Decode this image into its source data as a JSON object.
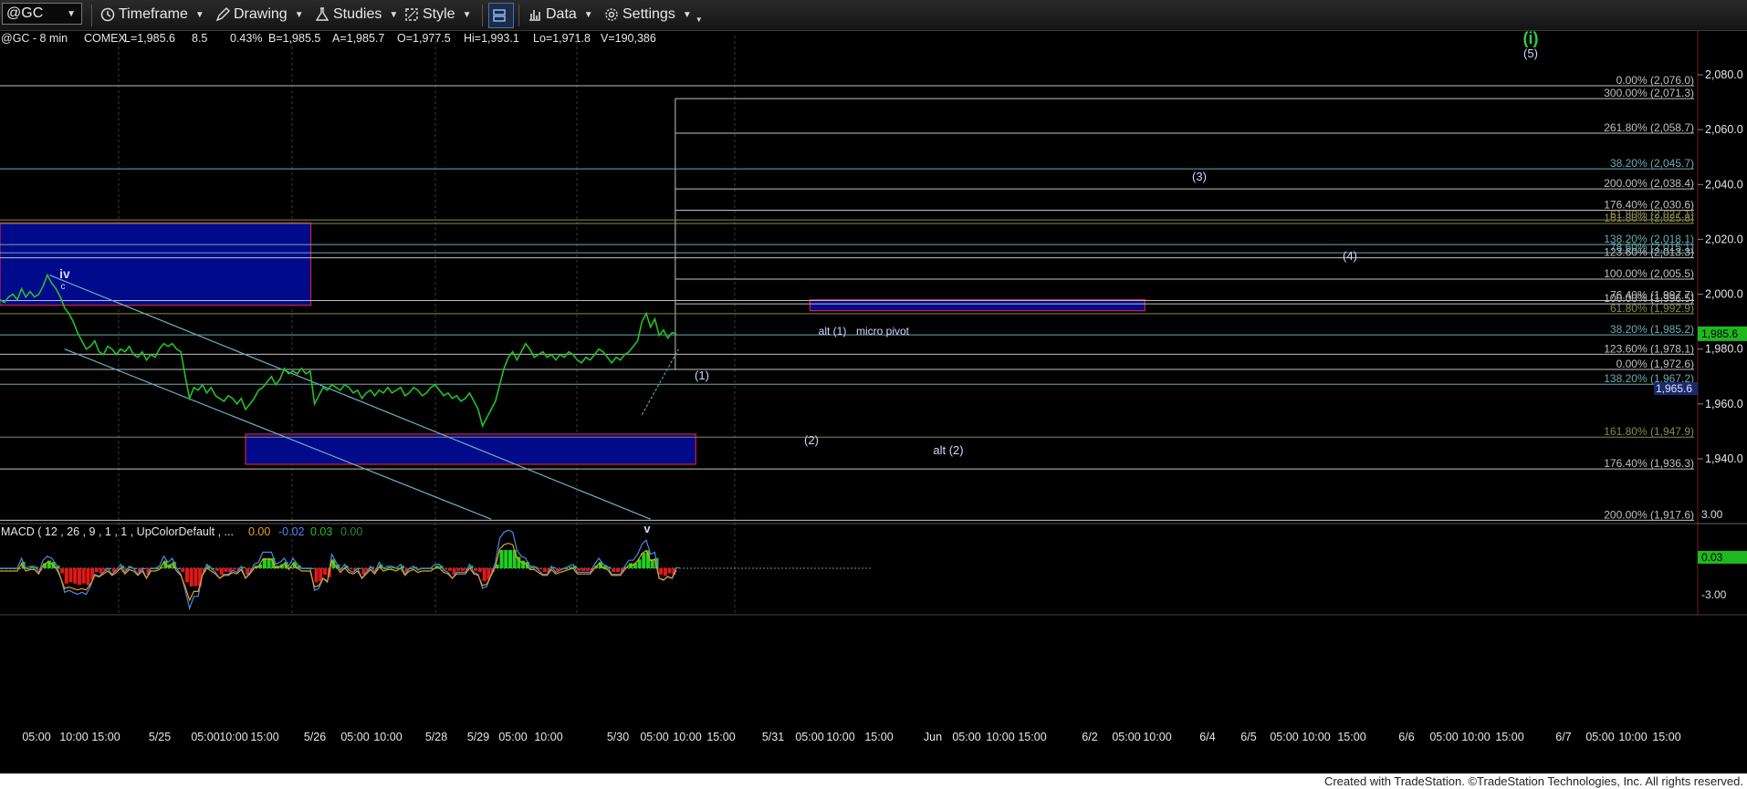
{
  "toolbar": {
    "symbol": "@GC",
    "timeframe": "Timeframe",
    "drawing": "Drawing",
    "studies": "Studies",
    "style": "Style",
    "data": "Data",
    "settings": "Settings"
  },
  "header": {
    "symbol": "@GC - 8 min",
    "exchange": "COMEX",
    "last": "L=1,985.6",
    "change": "8.5",
    "change_pct": "0.43%",
    "bid": "B=1,985.5",
    "ask": "A=1,985.7",
    "open": "O=1,977.5",
    "high": "Hi=1,993.1",
    "low": "Lo=1,971.8",
    "volume": "V=190,386"
  },
  "footer": "Created with TradeStation. ©TradeStation Technologies, Inc. All rights reserved.",
  "colors": {
    "price": "#22c02a",
    "fib_white": "#bfbfbf",
    "fib_olive": "#8a8a4e",
    "fib_teal": "#6aaab0",
    "box_fill": "#000a8a",
    "box_border": "#d02040",
    "channel": "#6ab0c0",
    "accent_green": "#2ecc40"
  },
  "chart_data": {
    "type": "line",
    "title": "@GC - 8 min",
    "ylim": [
      1910,
      2092
    ],
    "yticks": [
      "2,080.0",
      "2,060.0",
      "2,040.0",
      "2,020.0",
      "2,000.0",
      "1,980.0",
      "1,960.0",
      "1,940.0"
    ],
    "ytick_values": [
      2080,
      2060,
      2040,
      2020,
      2000,
      1980,
      1960,
      1940
    ],
    "last_price": "1,985.6",
    "last_value": 1985.6,
    "secondary_price_label": "1,965.6",
    "xticks": [
      "05:00",
      "10:00",
      "15:00",
      "5/25",
      "05:00",
      "10:00",
      "15:00",
      "5/26",
      "05:00",
      "10:00",
      "5/28",
      "5/29",
      "05:00",
      "10:00",
      "5/30",
      "05:00",
      "10:00",
      "15:00",
      "5/31",
      "05:00",
      "10:00",
      "15:00",
      "Jun",
      "05:00",
      "10:00",
      "15:00",
      "6/2",
      "05:00",
      "10:00",
      "6/4",
      "6/5",
      "05:00",
      "10:00",
      "15:00",
      "6/6",
      "05:00",
      "10:00",
      "15:00",
      "6/7",
      "05:00",
      "10:00",
      "15:00"
    ],
    "fib_levels": [
      {
        "label": "0.00% (2,076.0)",
        "value": 2076.0,
        "tone": "white"
      },
      {
        "label": "300.00% (2,071.3)",
        "value": 2071.3,
        "tone": "white"
      },
      {
        "label": "261.80% (2,058.7)",
        "value": 2058.7,
        "tone": "white"
      },
      {
        "label": "38.20% (2,045.7)",
        "value": 2045.7,
        "tone": "teal"
      },
      {
        "label": "200.00% (2,038.4)",
        "value": 2038.4,
        "tone": "white"
      },
      {
        "label": "176.40% (2,030.6)",
        "value": 2030.6,
        "tone": "white"
      },
      {
        "label": "61.80% (2,027.1)",
        "value": 2027.1,
        "tone": "olive"
      },
      {
        "label": "161.80% (2,025.8)",
        "value": 2025.8,
        "tone": "olive"
      },
      {
        "label": "138.20% (2,018.1)",
        "value": 2018.1,
        "tone": "teal"
      },
      {
        "label": "78.60% (2,015.1)",
        "value": 2015.1,
        "tone": "teal"
      },
      {
        "label": "123.60% (2,013.3)",
        "value": 2013.3,
        "tone": "white"
      },
      {
        "label": "100.00% (2,005.5)",
        "value": 2005.5,
        "tone": "white"
      },
      {
        "label": "76.40% (1,997.7)",
        "value": 1997.7,
        "tone": "white"
      },
      {
        "label": "100.00% (1,996.5)",
        "value": 1996.5,
        "tone": "white"
      },
      {
        "label": "61.80% (1,992.9)",
        "value": 1992.9,
        "tone": "olive"
      },
      {
        "label": "38.20% (1,985.2)",
        "value": 1985.2,
        "tone": "teal"
      },
      {
        "label": "123.60% (1,978.1)",
        "value": 1978.1,
        "tone": "white"
      },
      {
        "label": "0.00% (1,972.6)",
        "value": 1972.6,
        "tone": "white"
      },
      {
        "label": "138.20% (1,967.2)",
        "value": 1967.2,
        "tone": "teal"
      },
      {
        "label": "161.80% (1,947.9)",
        "value": 1947.9,
        "tone": "olive"
      },
      {
        "label": "176.40% (1,936.3)",
        "value": 1936.3,
        "tone": "white"
      },
      {
        "label": "200.00% (1,917.6)",
        "value": 1917.6,
        "tone": "white"
      }
    ],
    "wave_labels": [
      "iv",
      "c",
      "v",
      "(1)",
      "(2)",
      "alt (1)",
      "micro pivot",
      "alt (2)",
      "(3)",
      "(4)",
      "(5)",
      "(i)"
    ],
    "price_series": [
      [
        0,
        1998
      ],
      [
        0.02,
        1997
      ],
      [
        0.04,
        1999
      ],
      [
        0.06,
        2000
      ],
      [
        0.08,
        1998
      ],
      [
        0.1,
        2002
      ],
      [
        0.12,
        1999
      ],
      [
        0.14,
        2001
      ],
      [
        0.16,
        1999
      ],
      [
        0.18,
        2000
      ],
      [
        0.2,
        2003
      ],
      [
        0.22,
        2007
      ],
      [
        0.24,
        2004
      ],
      [
        0.26,
        2002
      ],
      [
        0.28,
        1999
      ],
      [
        0.3,
        1995
      ],
      [
        0.32,
        1993
      ],
      [
        0.34,
        1990
      ],
      [
        0.36,
        1986
      ],
      [
        0.38,
        1983
      ],
      [
        0.4,
        1980
      ],
      [
        0.42,
        1981
      ],
      [
        0.44,
        1983
      ],
      [
        0.46,
        1979
      ],
      [
        0.48,
        1978
      ],
      [
        0.5,
        1981
      ],
      [
        0.52,
        1980
      ],
      [
        0.54,
        1978
      ],
      [
        0.56,
        1980
      ],
      [
        0.58,
        1979
      ],
      [
        0.6,
        1981
      ],
      [
        0.62,
        1978
      ],
      [
        0.64,
        1977
      ],
      [
        0.66,
        1979
      ],
      [
        0.68,
        1976
      ],
      [
        0.7,
        1978
      ],
      [
        0.72,
        1977
      ],
      [
        0.74,
        1980
      ],
      [
        0.76,
        1982
      ],
      [
        0.78,
        1981
      ],
      [
        0.8,
        1982
      ],
      [
        0.82,
        1980
      ],
      [
        0.84,
        1979
      ],
      [
        0.86,
        1970
      ],
      [
        0.88,
        1962
      ],
      [
        0.9,
        1966
      ],
      [
        0.92,
        1965
      ],
      [
        0.94,
        1967
      ],
      [
        0.96,
        1964
      ],
      [
        0.98,
        1966
      ],
      [
        1.0,
        1963
      ],
      [
        1.02,
        1962
      ],
      [
        1.04,
        1961
      ],
      [
        1.06,
        1963
      ],
      [
        1.08,
        1962
      ],
      [
        1.1,
        1960
      ],
      [
        1.12,
        1962
      ],
      [
        1.14,
        1958
      ],
      [
        1.16,
        1960
      ],
      [
        1.18,
        1962
      ],
      [
        1.2,
        1965
      ],
      [
        1.22,
        1966
      ],
      [
        1.24,
        1968
      ],
      [
        1.26,
        1970
      ],
      [
        1.28,
        1967
      ],
      [
        1.3,
        1969
      ],
      [
        1.32,
        1973
      ],
      [
        1.34,
        1971
      ],
      [
        1.36,
        1972
      ],
      [
        1.38,
        1971
      ],
      [
        1.4,
        1973
      ],
      [
        1.42,
        1971
      ],
      [
        1.44,
        1972
      ],
      [
        1.46,
        1960
      ],
      [
        1.48,
        1963
      ],
      [
        1.5,
        1966
      ],
      [
        1.52,
        1965
      ],
      [
        1.54,
        1967
      ],
      [
        1.56,
        1966
      ],
      [
        1.58,
        1965
      ],
      [
        1.6,
        1967
      ],
      [
        1.62,
        1966
      ],
      [
        1.64,
        1964
      ],
      [
        1.66,
        1965
      ],
      [
        1.68,
        1962
      ],
      [
        1.7,
        1964
      ],
      [
        1.72,
        1965
      ],
      [
        1.74,
        1963
      ],
      [
        1.76,
        1965
      ],
      [
        1.78,
        1964
      ],
      [
        1.8,
        1966
      ],
      [
        1.82,
        1964
      ],
      [
        1.84,
        1965
      ],
      [
        1.86,
        1966
      ],
      [
        1.88,
        1963
      ],
      [
        1.9,
        1964
      ],
      [
        1.92,
        1966
      ],
      [
        1.94,
        1965
      ],
      [
        1.96,
        1963
      ],
      [
        1.98,
        1964
      ],
      [
        2.0,
        1966
      ],
      [
        2.02,
        1967
      ],
      [
        2.04,
        1965
      ],
      [
        2.06,
        1963
      ],
      [
        2.08,
        1964
      ],
      [
        2.1,
        1962
      ],
      [
        2.12,
        1963
      ],
      [
        2.14,
        1961
      ],
      [
        2.16,
        1962
      ],
      [
        2.18,
        1964
      ],
      [
        2.2,
        1961
      ],
      [
        2.22,
        1958
      ],
      [
        2.24,
        1952
      ],
      [
        2.26,
        1955
      ],
      [
        2.28,
        1958
      ],
      [
        2.3,
        1961
      ],
      [
        2.32,
        1967
      ],
      [
        2.34,
        1973
      ],
      [
        2.36,
        1977
      ],
      [
        2.38,
        1979
      ],
      [
        2.4,
        1976
      ],
      [
        2.42,
        1979
      ],
      [
        2.44,
        1982
      ],
      [
        2.46,
        1980
      ],
      [
        2.48,
        1977
      ],
      [
        2.5,
        1978
      ],
      [
        2.52,
        1979
      ],
      [
        2.54,
        1977
      ],
      [
        2.56,
        1978
      ],
      [
        2.58,
        1976
      ],
      [
        2.6,
        1978
      ],
      [
        2.62,
        1977
      ],
      [
        2.64,
        1979
      ],
      [
        2.66,
        1978
      ],
      [
        2.68,
        1976
      ],
      [
        2.7,
        1975
      ],
      [
        2.72,
        1977
      ],
      [
        2.74,
        1976
      ],
      [
        2.76,
        1978
      ],
      [
        2.78,
        1980
      ],
      [
        2.8,
        1979
      ],
      [
        2.82,
        1977
      ],
      [
        2.84,
        1975
      ],
      [
        2.86,
        1977
      ],
      [
        2.88,
        1976
      ],
      [
        2.9,
        1978
      ],
      [
        2.92,
        1979
      ],
      [
        2.94,
        1981
      ],
      [
        2.96,
        1983
      ],
      [
        2.98,
        1990
      ],
      [
        3.0,
        1993
      ],
      [
        3.02,
        1988
      ],
      [
        3.04,
        1991
      ],
      [
        3.06,
        1985
      ],
      [
        3.08,
        1987
      ],
      [
        3.1,
        1984
      ],
      [
        3.12,
        1986
      ],
      [
        3.14,
        1985.6
      ]
    ],
    "macd": {
      "label": "MACD ( 12 , 26 , 9 , 1 , 1 , UpColorDefault , ...",
      "values": [
        "0.00",
        "-0.02",
        "0.03",
        "0.00"
      ],
      "yticks": [
        "3.00",
        "-3.00"
      ],
      "last": "0.03"
    }
  }
}
